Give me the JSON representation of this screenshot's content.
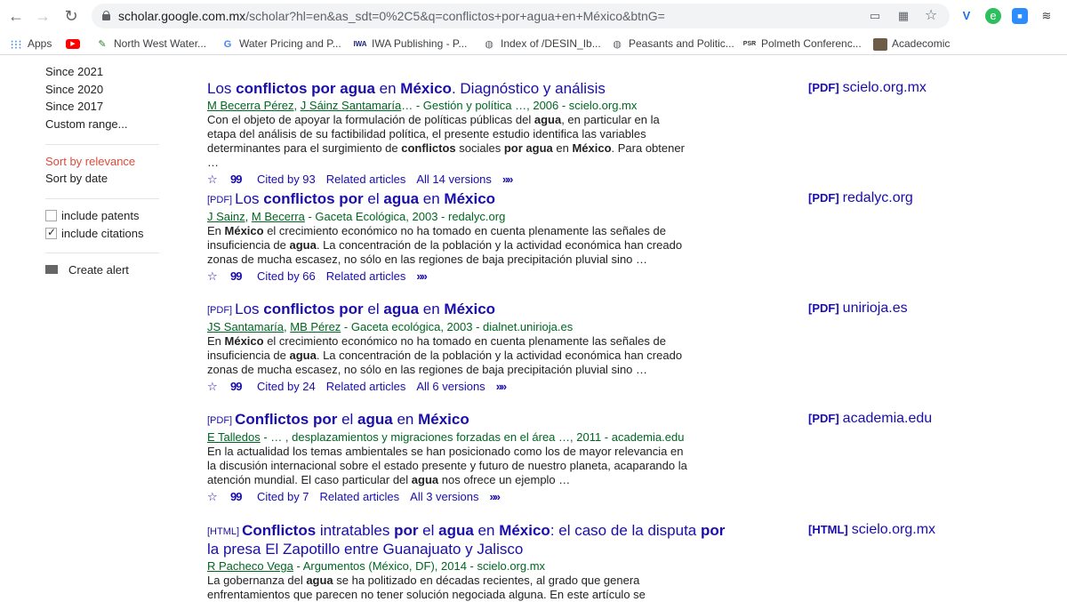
{
  "browser": {
    "url_host": "scholar.google.com.mx",
    "url_path": "/scholar?hl=en&as_sdt=0%2C5&q=conflictos+por+agua+en+México&btnG=",
    "bookmarks": [
      {
        "label": "Apps",
        "icon": "apps-grid-icon"
      },
      {
        "label": "",
        "icon": "youtube-icon"
      },
      {
        "label": "North West Water...",
        "icon": "bookmark-favicon"
      },
      {
        "label": "Water Pricing and P...",
        "icon": "google-icon"
      },
      {
        "label": "IWA Publishing - P...",
        "icon": "iwa-icon"
      },
      {
        "label": "Index of /DESIN_Ib...",
        "icon": "globe-icon"
      },
      {
        "label": "Peasants and Politic...",
        "icon": "globe-icon"
      },
      {
        "label": "Polmeth Conferenc...",
        "icon": "psa-icon"
      },
      {
        "label": "Academic",
        "icon": "academic-icon"
      }
    ],
    "bm_academic_label": "Acadecomic"
  },
  "sidebar": {
    "since_2021": "Since 2021",
    "since_2020": "Since 2020",
    "since_2017": "Since 2017",
    "custom_range": "Custom range...",
    "sort_relevance": "Sort by relevance",
    "sort_date": "Sort by date",
    "include_patents": "include patents",
    "include_citations": "include citations",
    "create_alert": "Create alert"
  },
  "results": [
    {
      "tag": "",
      "title_parts": [
        "Los ",
        "conflictos por agua",
        " en ",
        "México",
        ". Diagnóstico y análisis"
      ],
      "authors_u1": "M Becerra Pérez",
      "authors_u2": "J Sáinz Santamaría",
      "authors_rest": "… - Gestión y política …, 2006 - scielo.org.mx",
      "snippet": "Con el objeto de apoyar la formulación de políticas públicas del agua, en particular en la etapa del análisis de su factibilidad política, el presente estudio identifica las variables determinantes para el surgimiento de conflictos sociales por agua en México. Para obtener …",
      "cited": "Cited by 93",
      "related": "Related articles",
      "versions": "All 14 versions",
      "side_tag": "[PDF]",
      "side_domain": "scielo.org.mx"
    },
    {
      "tag": "[PDF]",
      "title_parts": [
        "Los ",
        "conflictos por",
        " el ",
        "agua",
        " en ",
        "México"
      ],
      "authors_u1": "J Sainz",
      "authors_u2": "M Becerra",
      "authors_rest": " - Gaceta Ecológica, 2003 - redalyc.org",
      "snippet": "En México el crecimiento económico no ha tomado en cuenta plenamente las señales de insuficiencia de agua. La concentración de la población y la actividad económica han creado zonas de mucha escasez, no sólo en las regiones de baja precipitación pluvial sino …",
      "cited": "Cited by 66",
      "related": "Related articles",
      "versions": "",
      "side_tag": "[PDF]",
      "side_domain": "redalyc.org"
    },
    {
      "tag": "[PDF]",
      "title_parts": [
        "Los ",
        "conflictos por",
        " el ",
        "agua",
        " en ",
        "México"
      ],
      "authors_u1": "JS Santamaría",
      "authors_u2": "MB Pérez",
      "authors_rest": " - Gaceta ecológica, 2003 - dialnet.unirioja.es",
      "snippet": "En México el crecimiento económico no ha tomado en cuenta plenamente las señales de insuficiencia de agua. La concentración de la población y la actividad económica han creado zonas de mucha escasez, no sólo en las regiones de baja precipitación pluvial sino …",
      "cited": "Cited by 24",
      "related": "Related articles",
      "versions": "All 6 versions",
      "side_tag": "[PDF]",
      "side_domain": "unirioja.es"
    },
    {
      "tag": "[PDF]",
      "title_parts": [
        "",
        "Conflictos por",
        " el ",
        "agua",
        " en ",
        "México"
      ],
      "authors_u1": "E Talledos",
      "authors_u2": "",
      "authors_rest": " - … , desplazamientos y migraciones forzadas en el área …, 2011 - academia.edu",
      "snippet": "En la actualidad los temas ambientales se han posicionado como los de mayor relevancia en la discusión internacional sobre el estado presente y futuro de nuestro planeta, acaparando la atención mundial. El caso particular del agua nos ofrece un ejemplo …",
      "cited": "Cited by 7",
      "related": "Related articles",
      "versions": "All 3 versions",
      "side_tag": "[PDF]",
      "side_domain": "academia.edu"
    },
    {
      "tag": "[HTML]",
      "title_parts": [
        "",
        "Conflictos",
        " intratables ",
        "por",
        " el ",
        "agua",
        " en ",
        "México",
        ": el caso de la disputa ",
        "por",
        " la presa El Zapotillo entre Guanajuato y Jalisco"
      ],
      "authors_u1": "R Pacheco Vega",
      "authors_u2": "",
      "authors_rest": " - Argumentos (México, DF), 2014 - scielo.org.mx",
      "snippet": "La gobernanza del agua se ha politizado en décadas recientes, al grado que genera enfrentamientos que parecen no tener solución negociada alguna. En este artículo se",
      "cited": "",
      "related": "",
      "versions": "",
      "side_tag": "[HTML]",
      "side_domain": "scielo.org.mx"
    }
  ]
}
